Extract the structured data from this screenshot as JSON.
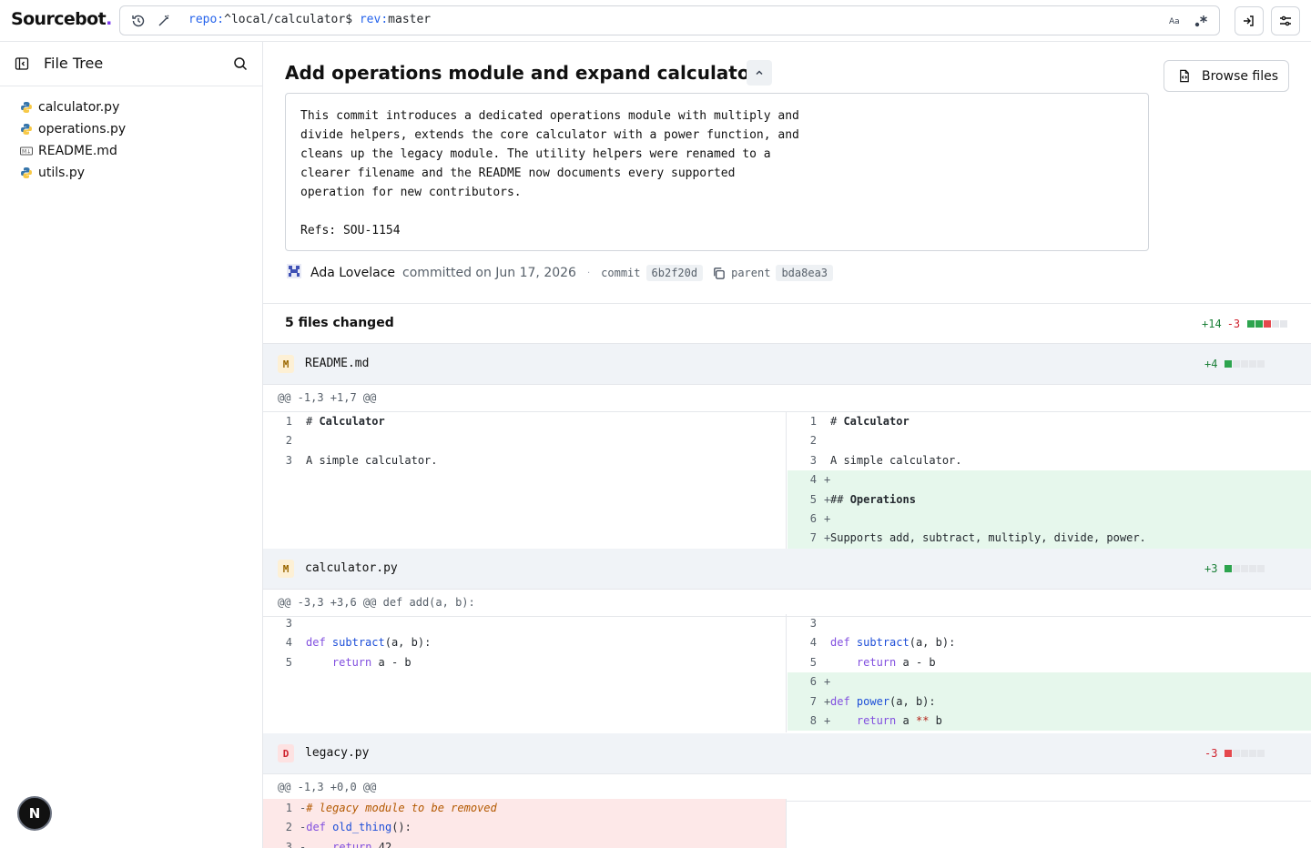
{
  "app": {
    "logo_text": "Sourcebot",
    "logo_dot": "."
  },
  "search": {
    "query_repo_key": "repo:",
    "query_repo_val": "^local/calculator$ ",
    "query_rev_key": "rev:",
    "query_rev_val": "master"
  },
  "sidebar": {
    "title": "File Tree",
    "files": [
      {
        "name": "calculator.py",
        "icon": "python-icon"
      },
      {
        "name": "operations.py",
        "icon": "python-icon"
      },
      {
        "name": "README.md",
        "icon": "markdown-icon"
      },
      {
        "name": "utils.py",
        "icon": "python-icon"
      }
    ],
    "badge": "N"
  },
  "commit": {
    "title": "Add operations module and expand calculator",
    "browse_label": "Browse files",
    "message": "This commit introduces a dedicated operations module with multiply and\ndivide helpers, extends the core calculator with a power function, and\ncleans up the legacy module. The utility helpers were renamed to a\nclearer filename and the README now documents every supported\noperation for new contributors.\n\nRefs: SOU-1154",
    "author": "Ada Lovelace",
    "when": "committed on Jun 17, 2026",
    "sep": "·",
    "commit_label": "commit",
    "sha": "6b2f20d",
    "parent_label": "parent",
    "parent_sha": "bda8ea3"
  },
  "summary": {
    "title": "5 files changed",
    "additions": "+14",
    "deletions": "-3"
  },
  "files": [
    {
      "status": "M",
      "name": "README.md",
      "additions": "+4",
      "hunk": "@@ -1,3 +1,7 @@"
    },
    {
      "status": "M",
      "name": "calculator.py",
      "additions": "+3",
      "hunk": "@@ -3,3 +3,6 @@ def add(a, b):"
    },
    {
      "status": "D",
      "name": "legacy.py",
      "deletions": "-3",
      "hunk": "@@ -1,3 +0,0 @@"
    }
  ],
  "diff": {
    "readme_left": [
      {
        "n": "1",
        "hash": "# ",
        "text": "Calculator"
      },
      {
        "n": "2",
        "text": ""
      },
      {
        "n": "3",
        "text": "A simple calculator."
      }
    ],
    "readme_right": [
      {
        "n": "1",
        "hash": "# ",
        "text": "Calculator"
      },
      {
        "n": "2",
        "text": ""
      },
      {
        "n": "3",
        "text": "A simple calculator."
      },
      {
        "n": "4",
        "mk": "+",
        "text": ""
      },
      {
        "n": "5",
        "mk": "+",
        "hash": "## ",
        "text": "Operations"
      },
      {
        "n": "6",
        "mk": "+",
        "text": ""
      },
      {
        "n": "7",
        "mk": "+",
        "text": "Supports add, subtract, multiply, divide, power."
      }
    ],
    "calc_nums_left": [
      "3",
      "4",
      "5"
    ],
    "calc_nums_right": [
      "3",
      "4",
      "5",
      "6",
      "7",
      "8"
    ],
    "calc": {
      "def": "def",
      "subtract": "subtract",
      "args": "(a, b):",
      "return": "return",
      "a_minus_b": "a - b",
      "power": "power",
      "a_pow_b": "a ** b",
      "a": "a",
      "pow_op": "**",
      "b": "b",
      "minus": "-"
    },
    "legacy": {
      "n1": "1",
      "n2": "2",
      "n3": "3",
      "comment": "# legacy module to be removed",
      "fn": "old_thing",
      "call": "():",
      "ret_val": "42"
    }
  }
}
